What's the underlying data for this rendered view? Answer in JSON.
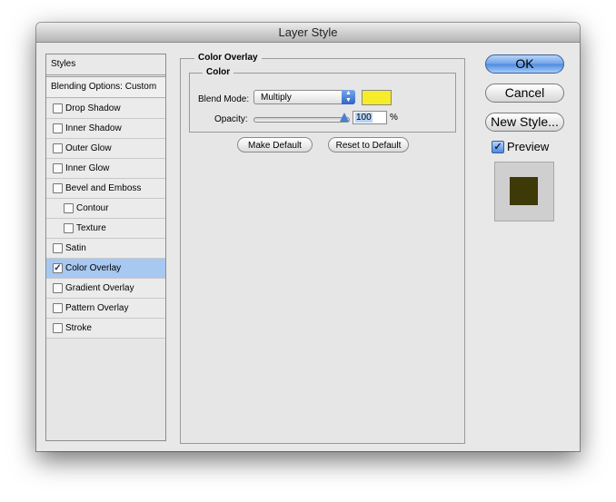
{
  "window": {
    "title": "Layer Style"
  },
  "sidebar": {
    "header": "Styles",
    "blending": "Blending Options: Custom",
    "items": [
      {
        "label": "Drop Shadow",
        "checked": false,
        "selected": false,
        "indent": false
      },
      {
        "label": "Inner Shadow",
        "checked": false,
        "selected": false,
        "indent": false
      },
      {
        "label": "Outer Glow",
        "checked": false,
        "selected": false,
        "indent": false
      },
      {
        "label": "Inner Glow",
        "checked": false,
        "selected": false,
        "indent": false
      },
      {
        "label": "Bevel and Emboss",
        "checked": false,
        "selected": false,
        "indent": false
      },
      {
        "label": "Contour",
        "checked": false,
        "selected": false,
        "indent": true
      },
      {
        "label": "Texture",
        "checked": false,
        "selected": false,
        "indent": true
      },
      {
        "label": "Satin",
        "checked": false,
        "selected": false,
        "indent": false
      },
      {
        "label": "Color Overlay",
        "checked": true,
        "selected": true,
        "indent": false
      },
      {
        "label": "Gradient Overlay",
        "checked": false,
        "selected": false,
        "indent": false
      },
      {
        "label": "Pattern Overlay",
        "checked": false,
        "selected": false,
        "indent": false
      },
      {
        "label": "Stroke",
        "checked": false,
        "selected": false,
        "indent": false
      }
    ]
  },
  "panel": {
    "title": "Color Overlay",
    "group_title": "Color",
    "blend_mode_label": "Blend Mode:",
    "blend_mode_value": "Multiply",
    "overlay_color": "#f6ec2a",
    "opacity_label": "Opacity:",
    "opacity_value": "100",
    "opacity_unit": "%",
    "make_default": "Make Default",
    "reset_default": "Reset to Default"
  },
  "actions": {
    "ok": "OK",
    "cancel": "Cancel",
    "new_style": "New Style...",
    "preview_label": "Preview",
    "preview_checked": true,
    "preview_color": "#3d3a07"
  },
  "colors": {
    "selected_row": "#a7c8f1",
    "accent": "#4c89df"
  }
}
